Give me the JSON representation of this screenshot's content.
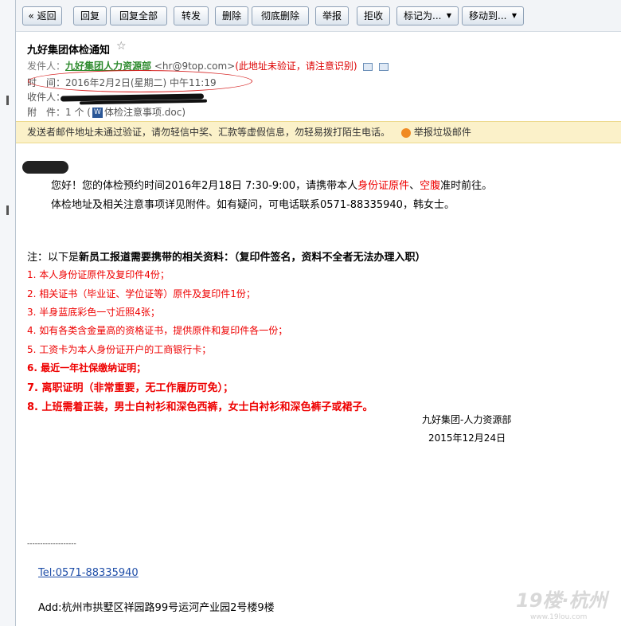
{
  "toolbar": {
    "back": "« 返回",
    "reply": "回复",
    "reply_all": "回复全部",
    "forward": "转发",
    "delete": "删除",
    "delete_permanent": "彻底删除",
    "report": "举报",
    "reject": "拒收",
    "mark_as": "标记为...",
    "move_to": "移动到...",
    "dropdown_glyph": "▼"
  },
  "email": {
    "subject": "九好集团体检通知",
    "star_glyph": "☆",
    "sender_label": "发件人：",
    "sender_name": "九好集团人力资源部",
    "sender_email": " <hr@9top.com>",
    "sender_warning": "(此地址未验证，请注意识别)",
    "time_label": "时　间：",
    "time_value": "2016年2月2日(星期二) 中午11:19",
    "recipient_label": "收件人：",
    "attachment_label": "附　件：",
    "attachment_count": "1 个 (",
    "attachment_icon_glyph": "W",
    "attachment_name": "体检注意事项.doc)"
  },
  "warning_bar": {
    "text": "发送者邮件地址未通过验证，请勿轻信中奖、汇款等虚假信息，勿轻易拨打陌生电话。",
    "report_link": "举报垃圾邮件"
  },
  "body": {
    "line1_a": "您好！您的体检预约时间2016年2月18日 7:30-9:00，请携带本人",
    "line1_red1": "身份证原件",
    "line1_sep": "、",
    "line1_red2": "空腹",
    "line1_b": "准时前往。",
    "line2": "体检地址及相关注意事项详见附件。如有疑问，可电话联系0571-88335940，韩女士。",
    "note_prefix": "注：以下是",
    "note_bold": "新员工报道需要携带的相关资料：（复印件签名，资料不全者无法办理入职）",
    "items": [
      "1.  本人身份证原件及复印件4份；",
      "2. 相关证书（毕业证、学位证等）原件及复印件1份；",
      "3.  半身蓝底彩色一寸近照4张；",
      "4.  如有各类含金量高的资格证书，提供原件和复印件各一份；",
      "5.  工资卡为本人身份证开户的工商银行卡；",
      "6.  最近一年社保缴纳证明；",
      "7. 离职证明（非常重要，无工作履历可免）；",
      "8. 上班需着正装，男士白衬衫和深色西裤，女士白衬衫和深色裤子或裙子。"
    ],
    "signature_org": "九好集团-人力资源部",
    "signature_date": "2015年12月24日",
    "separator": "-------------------",
    "tel": "Tel:0571-88335940",
    "address": "Add:杭州市拱墅区祥园路99号运河产业园2号楼9楼"
  },
  "watermark": {
    "brand": "19楼·杭州",
    "url": "www.19lou.com"
  }
}
